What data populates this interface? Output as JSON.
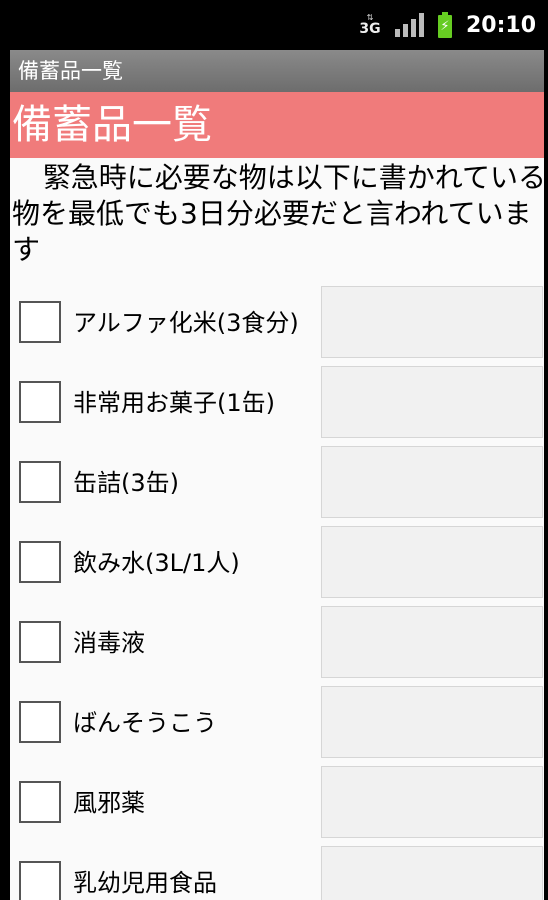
{
  "status_bar": {
    "network_label": "3G",
    "network_arrows": "⇅",
    "battery_glyph": "⚡",
    "time": "20:10"
  },
  "app": {
    "window_title": "備蓄品一覧",
    "heading": "備蓄品一覧",
    "intro_text": "緊急時に必要な物は以下に書かれている物を最低でも3日分必要だと言われています",
    "heading_color": "#f07b7b"
  },
  "items": [
    {
      "label": "アルファ化米(3食分)",
      "checked": false,
      "value": ""
    },
    {
      "label": "非常用お菓子(1缶)",
      "checked": false,
      "value": ""
    },
    {
      "label": "缶詰(3缶)",
      "checked": false,
      "value": ""
    },
    {
      "label": "飲み水(3L/1人)",
      "checked": false,
      "value": ""
    },
    {
      "label": "消毒液",
      "checked": false,
      "value": ""
    },
    {
      "label": "ばんそうこう",
      "checked": false,
      "value": ""
    },
    {
      "label": "風邪薬",
      "checked": false,
      "value": ""
    },
    {
      "label": "乳幼児用食品",
      "checked": false,
      "value": ""
    }
  ]
}
